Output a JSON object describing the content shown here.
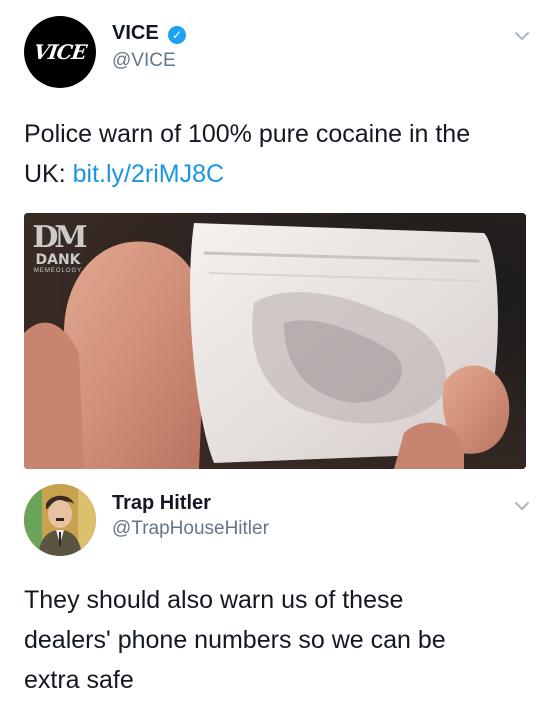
{
  "tweet1": {
    "avatar_logo": "VICE",
    "display_name": "VICE",
    "verified": true,
    "handle": "@VICE",
    "text_before_link": "Police warn of 100% pure cocaine in the UK: ",
    "text_line1": "Police warn of 100% pure cocaine in the",
    "text_line2_prefix": "UK: ",
    "link": "bit.ly/2riMJ8C",
    "media": {
      "watermark_mark": "DM",
      "watermark_word": "DANK",
      "watermark_sub": "MEMEOLOGY"
    },
    "menu_icon": "chevron-down-icon"
  },
  "tweet2": {
    "display_name": "Trap Hitler",
    "handle": "@TrapHouseHitler",
    "text_line1": "They should also warn us of these",
    "text_line2": "dealers' phone numbers so we can be",
    "text_line3": "extra safe",
    "menu_icon": "chevron-down-icon"
  },
  "colors": {
    "text": "#141823",
    "secondary": "#657786",
    "link": "#1b95e0",
    "verified": "#1da1f2"
  }
}
